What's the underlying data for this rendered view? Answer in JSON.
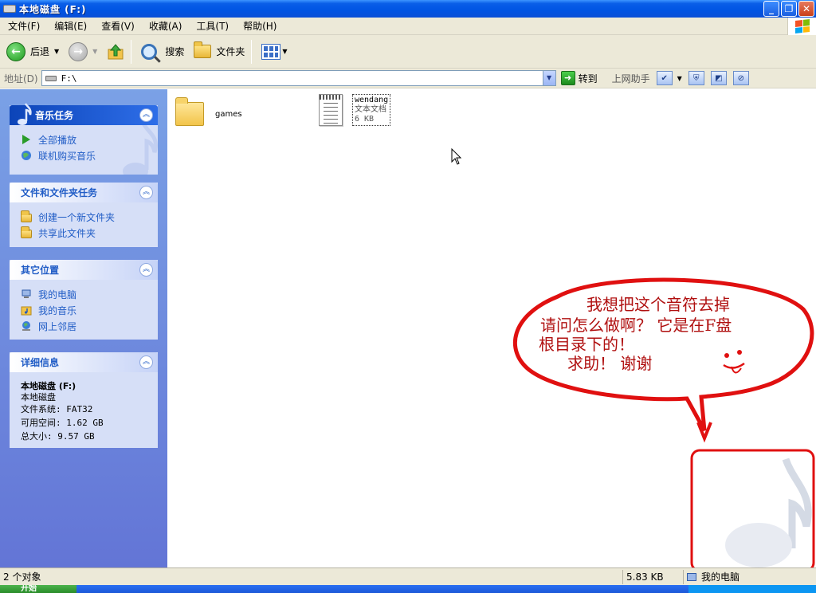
{
  "window": {
    "title": "本地磁盘 (F:)",
    "buttons": [
      "minimize",
      "restore",
      "close"
    ]
  },
  "menu": {
    "items": [
      "文件(F)",
      "编辑(E)",
      "查看(V)",
      "收藏(A)",
      "工具(T)",
      "帮助(H)"
    ]
  },
  "toolbar": {
    "back_label": "后退",
    "search_label": "搜索",
    "folders_label": "文件夹"
  },
  "address": {
    "label": "地址(D)",
    "value": "F:\\",
    "go_label": "转到",
    "helper_label": "上网助手"
  },
  "left_panel": {
    "music_tasks": {
      "title": "音乐任务",
      "links": [
        "全部播放",
        "联机购买音乐"
      ]
    },
    "file_tasks": {
      "title": "文件和文件夹任务",
      "links": [
        "创建一个新文件夹",
        "共享此文件夹"
      ]
    },
    "other_places": {
      "title": "其它位置",
      "links": [
        "我的电脑",
        "我的音乐",
        "网上邻居"
      ]
    },
    "details": {
      "title": "详细信息",
      "name": "本地磁盘 (F:)",
      "type": "本地磁盘",
      "fs": "文件系统: FAT32",
      "free": "可用空间: 1.62 GB",
      "total": "总大小: 9.57 GB"
    }
  },
  "files": [
    {
      "name": "games",
      "type": "folder"
    },
    {
      "name": "wendang",
      "type_label": "文本文档",
      "size": "6 KB"
    }
  ],
  "annotation": {
    "lines": [
      "我想把这个音符去掉",
      "请问怎么做啊？  它是在F盘",
      "根目录下的！",
      "求助！   谢谢"
    ],
    "color": "#e01010"
  },
  "status": {
    "count": "2 个对象",
    "size": "5.83 KB",
    "location": "我的电脑"
  },
  "taskbar": {
    "start_label": "开始"
  }
}
